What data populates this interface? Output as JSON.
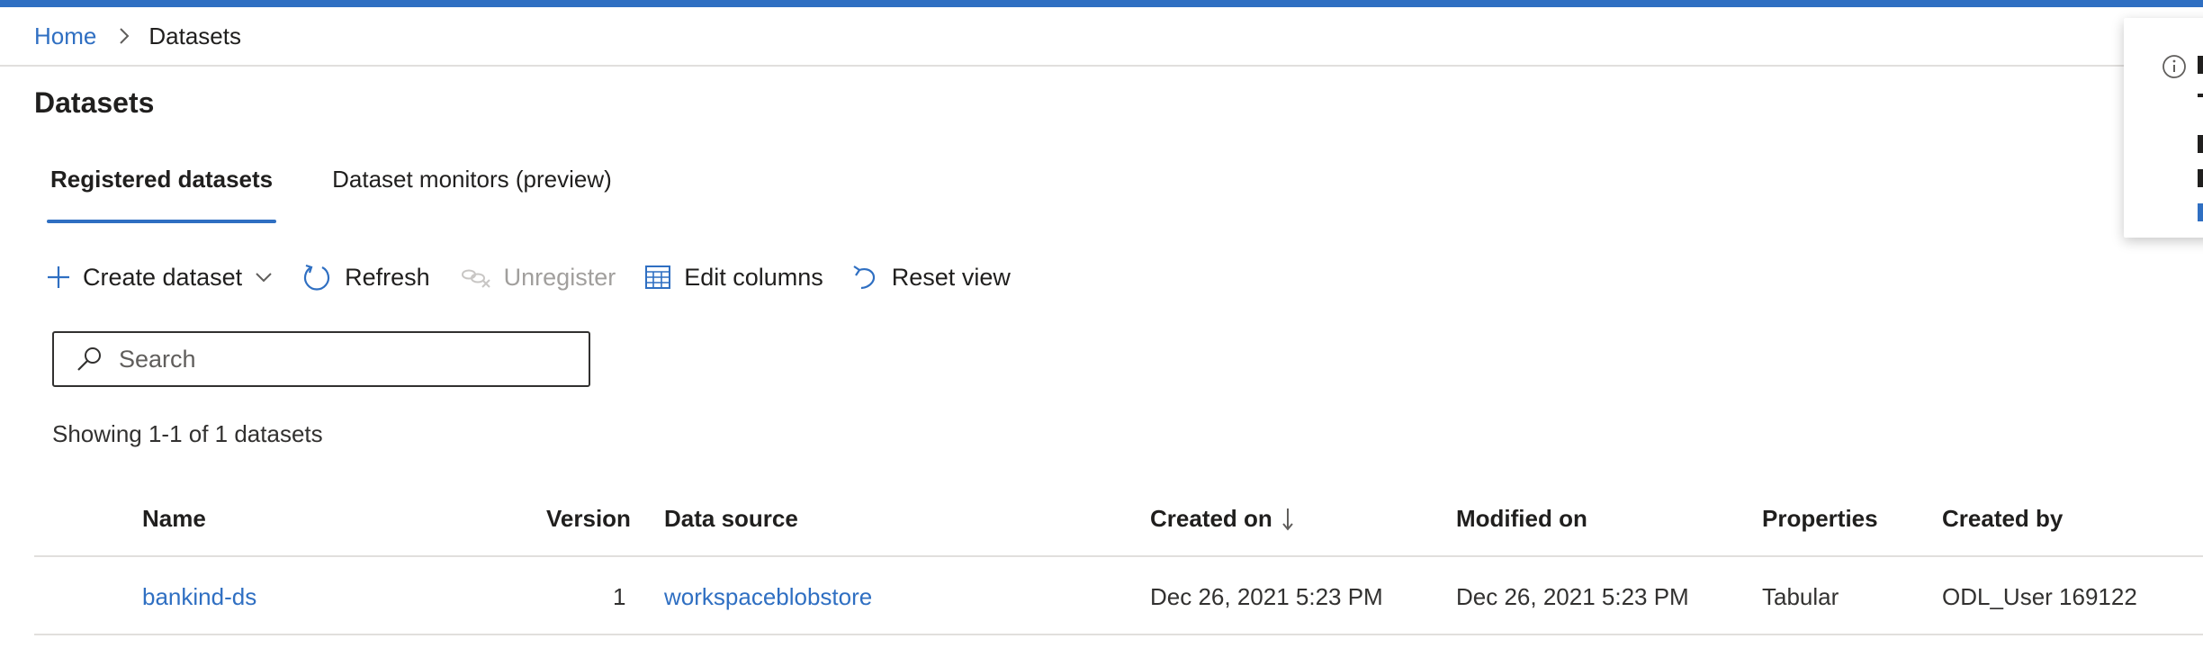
{
  "breadcrumb": {
    "home": "Home",
    "current": "Datasets"
  },
  "page": {
    "title": "Datasets"
  },
  "tabs": [
    {
      "label": "Registered datasets",
      "active": true
    },
    {
      "label": "Dataset monitors (preview)",
      "active": false
    }
  ],
  "toolbar": {
    "create": "Create dataset",
    "refresh": "Refresh",
    "unregister": "Unregister",
    "edit_columns": "Edit columns",
    "reset_view": "Reset view"
  },
  "search": {
    "placeholder": "Search"
  },
  "status": {
    "showing": "Showing 1-1 of 1 datasets"
  },
  "table": {
    "columns": {
      "name": "Name",
      "version": "Version",
      "data_source": "Data source",
      "created_on": "Created on",
      "modified_on": "Modified on",
      "properties": "Properties",
      "created_by": "Created by"
    },
    "rows": [
      {
        "name": "bankind-ds",
        "version": "1",
        "data_source": "workspaceblobstore",
        "created_on": "Dec 26, 2021 5:23 PM",
        "modified_on": "Dec 26, 2021 5:23 PM",
        "properties": "Tabular",
        "created_by": "ODL_User 169122"
      }
    ]
  },
  "colors": {
    "accent": "#2f6fc2",
    "text": "#201f1e",
    "disabled": "#a19f9d",
    "divider": "#e1dfdd"
  },
  "icons": [
    "chevron-right-icon",
    "plus-icon",
    "chevron-down-icon",
    "refresh-icon",
    "unregister-icon",
    "table-icon",
    "undo-icon",
    "search-icon",
    "sort-down-icon",
    "info-icon"
  ]
}
